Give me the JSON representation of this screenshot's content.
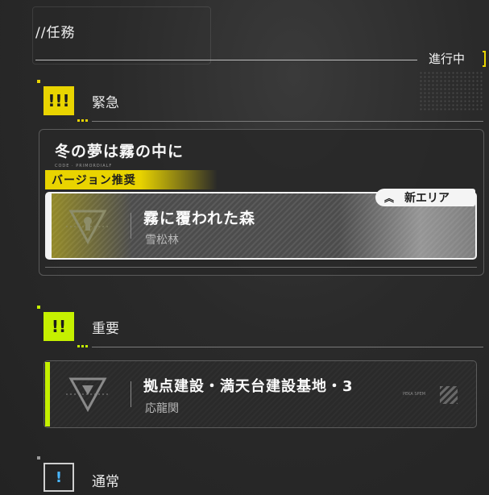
{
  "header": {
    "title": "//任務",
    "status": "進行中"
  },
  "sections": {
    "urgent": {
      "icon_text": "!!!",
      "label": "緊急",
      "color": "#e9d400"
    },
    "important": {
      "icon_text": "!!",
      "label": "重要",
      "color": "#c5f000"
    },
    "normal": {
      "icon_text": "!",
      "label": "通常",
      "color": "#ffffff"
    }
  },
  "urgent_quest": {
    "name": "冬の夢は霧の中に",
    "tag": "バージョン推奨",
    "area_name": "霧に覆われた森",
    "area_sub": "雪松林",
    "badge_icon": "double-chevron-up-icon",
    "badge": "新エリア"
  },
  "important_quest": {
    "area_name": "拠点建設・満天台建設基地・3",
    "area_sub": "応龍関"
  }
}
